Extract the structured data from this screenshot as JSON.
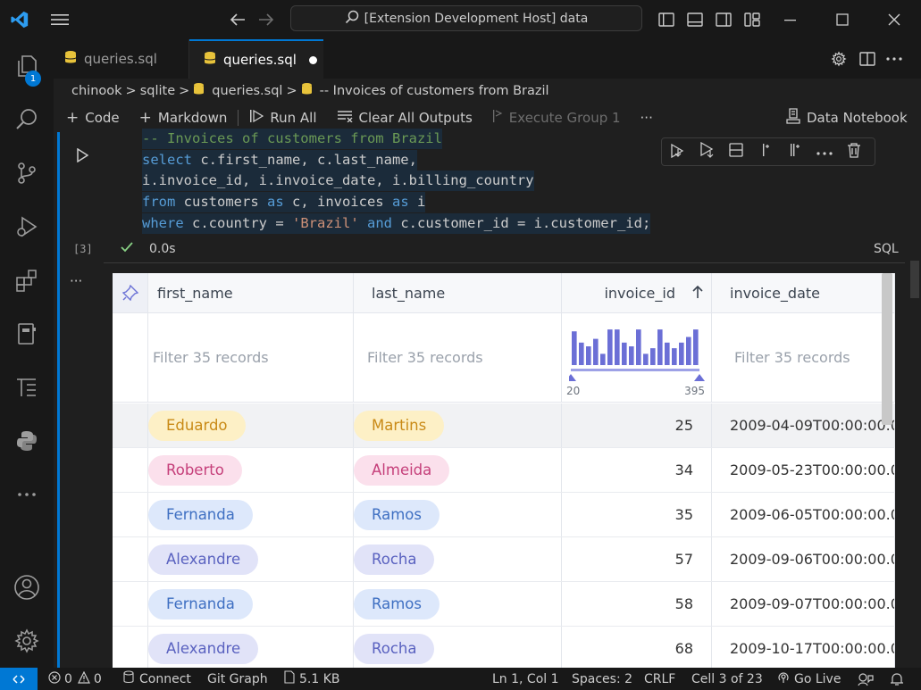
{
  "titlebar": {
    "search_text": "[Extension Development Host] data"
  },
  "activity": {
    "explorer_badge": "1"
  },
  "tabs": [
    {
      "label": "queries.sql",
      "active": false
    },
    {
      "label": "queries.sql",
      "active": true
    }
  ],
  "breadcrumb": {
    "items": [
      "chinook",
      ">",
      "sqlite",
      ">",
      "queries.sql",
      ">",
      "-- Invoices of customers from Brazil"
    ]
  },
  "toolbar": {
    "code": "Code",
    "markdown": "Markdown",
    "run_all": "Run All",
    "clear_outputs": "Clear All Outputs",
    "execute_group": "Execute Group 1",
    "more": "···",
    "data_notebook": "Data Notebook"
  },
  "cell": {
    "exec_count": "[3]",
    "duration": "0.0s",
    "language": "SQL",
    "code_lines": [
      [
        {
          "t": "cm",
          "v": "-- Invoices of customers from Brazil"
        }
      ],
      [
        {
          "t": "kw",
          "v": "select"
        },
        {
          "t": "pl",
          "v": " c.first_name, c.last_name,"
        }
      ],
      [
        {
          "t": "pl",
          "v": "i.invoice_id, i.invoice_date, i.billing_country"
        }
      ],
      [
        {
          "t": "kw",
          "v": "from"
        },
        {
          "t": "pl",
          "v": " customers "
        },
        {
          "t": "kw",
          "v": "as"
        },
        {
          "t": "pl",
          "v": " c, invoices "
        },
        {
          "t": "kw",
          "v": "as"
        },
        {
          "t": "pl",
          "v": " i"
        }
      ],
      [
        {
          "t": "kw",
          "v": "where"
        },
        {
          "t": "pl",
          "v": " c.country = "
        },
        {
          "t": "str",
          "v": "'Brazil'"
        },
        {
          "t": "pl",
          "v": " "
        },
        {
          "t": "kw",
          "v": "and"
        },
        {
          "t": "pl",
          "v": " c.customer_id = i.customer_id;"
        }
      ]
    ]
  },
  "output": {
    "more": "···",
    "columns": [
      "first_name",
      "last_name",
      "invoice_id",
      "invoice_date"
    ],
    "filter_placeholder": "Filter 35 records",
    "histogram": {
      "min_label": "20",
      "max_label": "395",
      "bins": [
        0.9,
        0.6,
        0.5,
        0.7,
        0.3,
        0.95,
        0.95,
        0.6,
        0.5,
        0.95,
        0.3,
        0.45,
        0.95,
        0.6,
        0.45,
        0.6,
        0.75,
        0.95
      ]
    },
    "rows": [
      {
        "first_name": "Eduardo",
        "last_name": "Martins",
        "invoice_id": "25",
        "invoice_date": "2009-04-09T00:00:00.0",
        "fg": "#c98a16",
        "bg": "#fdf0c6"
      },
      {
        "first_name": "Roberto",
        "last_name": "Almeida",
        "invoice_id": "34",
        "invoice_date": "2009-05-23T00:00:00.0",
        "fg": "#c53f7a",
        "bg": "#fbe0ec"
      },
      {
        "first_name": "Fernanda",
        "last_name": "Ramos",
        "invoice_id": "35",
        "invoice_date": "2009-06-05T00:00:00.0",
        "fg": "#3e6fc2",
        "bg": "#dde8fb"
      },
      {
        "first_name": "Alexandre",
        "last_name": "Rocha",
        "invoice_id": "57",
        "invoice_date": "2009-09-06T00:00:00.0",
        "fg": "#5a62c0",
        "bg": "#e1e3f8"
      },
      {
        "first_name": "Fernanda",
        "last_name": "Ramos",
        "invoice_id": "58",
        "invoice_date": "2009-09-07T00:00:00.0",
        "fg": "#3e6fc2",
        "bg": "#dde8fb"
      },
      {
        "first_name": "Alexandre",
        "last_name": "Rocha",
        "invoice_id": "68",
        "invoice_date": "2009-10-17T00:00:00.0",
        "fg": "#5a62c0",
        "bg": "#e1e3f8"
      }
    ]
  },
  "statusbar": {
    "errors": "0",
    "warnings": "0",
    "connect": "Connect",
    "git_graph": "Git Graph",
    "file_size": "5.1 KB",
    "position": "Ln 1, Col 1",
    "spaces": "Spaces: 2",
    "eol": "CRLF",
    "cell": "Cell 3 of 23",
    "go_live": "Go Live"
  }
}
